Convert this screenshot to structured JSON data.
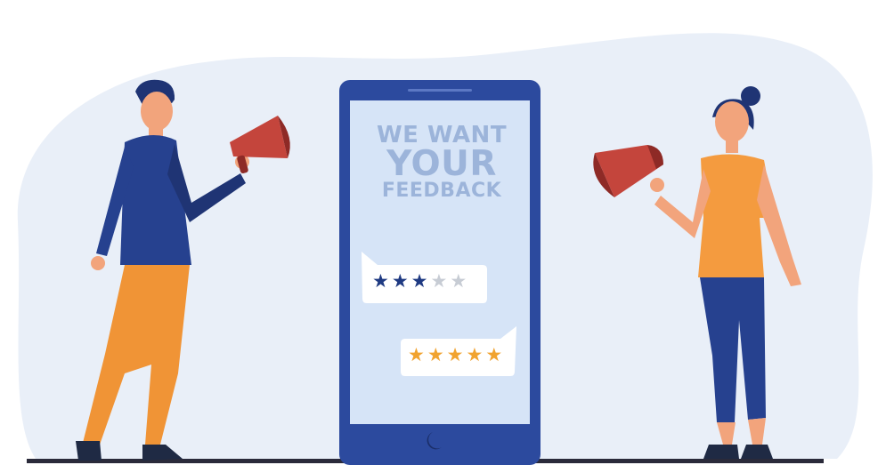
{
  "headline": {
    "line1": "WE WANT",
    "line2": "YOUR",
    "line3": "FEEDBACK"
  },
  "ratings": [
    {
      "filled": 3,
      "total": 5,
      "filled_color": "#1f3a82",
      "empty_color": "#c7ccd4"
    },
    {
      "filled": 5,
      "total": 5,
      "filled_color": "#f1a32f",
      "empty_color": "#c7ccd4"
    }
  ],
  "colors": {
    "backdrop": "#e9eff8",
    "phone_frame": "#2c4a9e",
    "phone_screen": "#d6e4f7",
    "headline": "#9cb4da",
    "shirt_navy": "#26418f",
    "pants_orange": "#f09436",
    "megaphone": "#c4453c"
  }
}
